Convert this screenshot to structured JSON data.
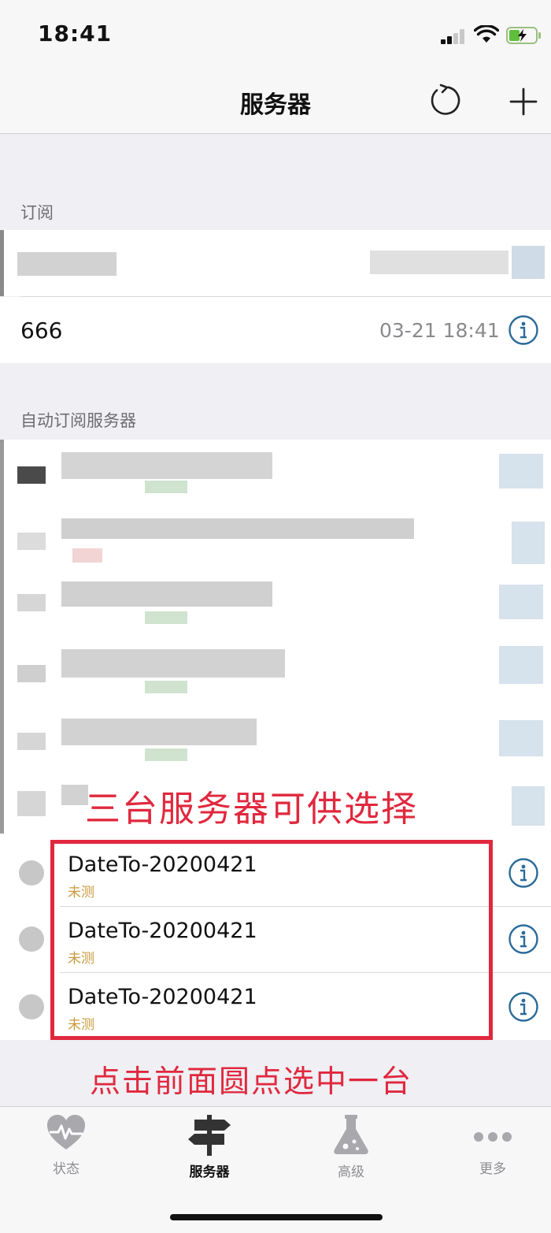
{
  "status_bar": {
    "time": "18:41"
  },
  "nav": {
    "title": "服务器"
  },
  "subscription": {
    "header": "订阅",
    "rows": [
      {
        "name": "666",
        "time": "03-21 18:41"
      }
    ]
  },
  "auto_servers": {
    "header": "自动订阅服务器"
  },
  "servers": [
    {
      "name": "DateTo-20200421",
      "status": "未测"
    },
    {
      "name": "DateTo-20200421",
      "status": "未测"
    },
    {
      "name": "DateTo-20200421",
      "status": "未测"
    }
  ],
  "annotations": {
    "top": "三台服务器可供选择",
    "bottom": "点击前面圆点选中一台",
    "color": "#e0283e"
  },
  "tabs": [
    {
      "label": "状态",
      "icon": "heart-pulse-icon"
    },
    {
      "label": "服务器",
      "icon": "signpost-icon"
    },
    {
      "label": "高级",
      "icon": "flask-icon"
    },
    {
      "label": "更多",
      "icon": "more-dots-icon"
    }
  ],
  "colors": {
    "accent": "#2a6b99",
    "status_untested": "#c99a3c"
  }
}
